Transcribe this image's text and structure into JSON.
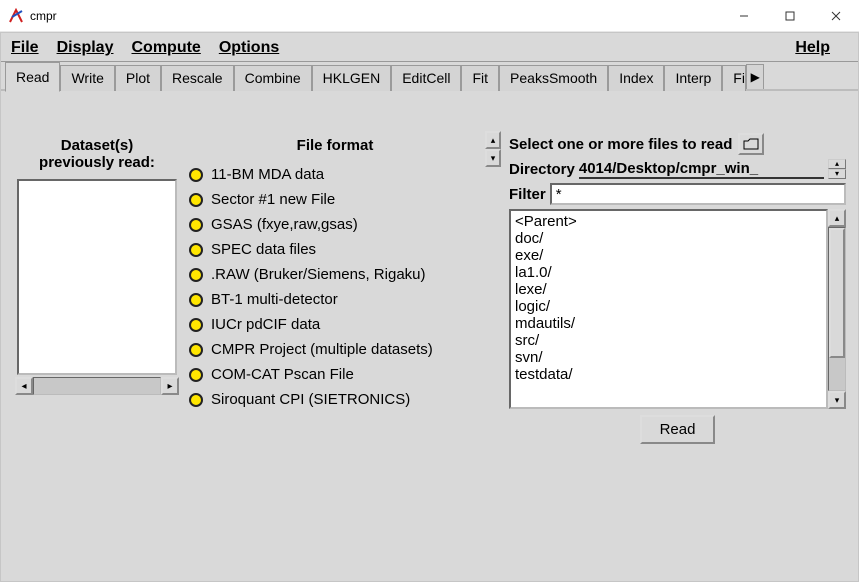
{
  "window": {
    "title": "cmpr"
  },
  "menubar": {
    "file": "File",
    "display": "Display",
    "compute": "Compute",
    "options": "Options",
    "help": "Help"
  },
  "tabs": [
    "Read",
    "Write",
    "Plot",
    "Rescale",
    "Combine",
    "HKLGEN",
    "EditCell",
    "Fit",
    "PeaksSmooth",
    "Index",
    "Interp",
    "Fit"
  ],
  "active_tab": 0,
  "left_panel": {
    "heading_line1": "Dataset(s)",
    "heading_line2": "previously read:"
  },
  "formats": {
    "heading": "File format",
    "items": [
      "11-BM MDA data",
      "Sector #1 new File",
      "GSAS (fxye,raw,gsas)",
      "SPEC data files",
      ".RAW (Bruker/Siemens, Rigaku)",
      "BT-1 multi-detector",
      "IUCr pdCIF data",
      "CMPR Project (multiple datasets)",
      "COM-CAT Pscan File",
      "Siroquant CPI (SIETRONICS)"
    ]
  },
  "filebox": {
    "select_label": "Select one or more files to read",
    "dir_label": "Directory",
    "dir_value": "4014/Desktop/cmpr_win_",
    "filter_label": "Filter",
    "filter_value": "*",
    "items": [
      "<Parent>",
      "doc/",
      "exe/",
      "la1.0/",
      "lexe/",
      "logic/",
      "mdautils/",
      "src/",
      "svn/",
      "testdata/"
    ],
    "read_button": "Read"
  }
}
